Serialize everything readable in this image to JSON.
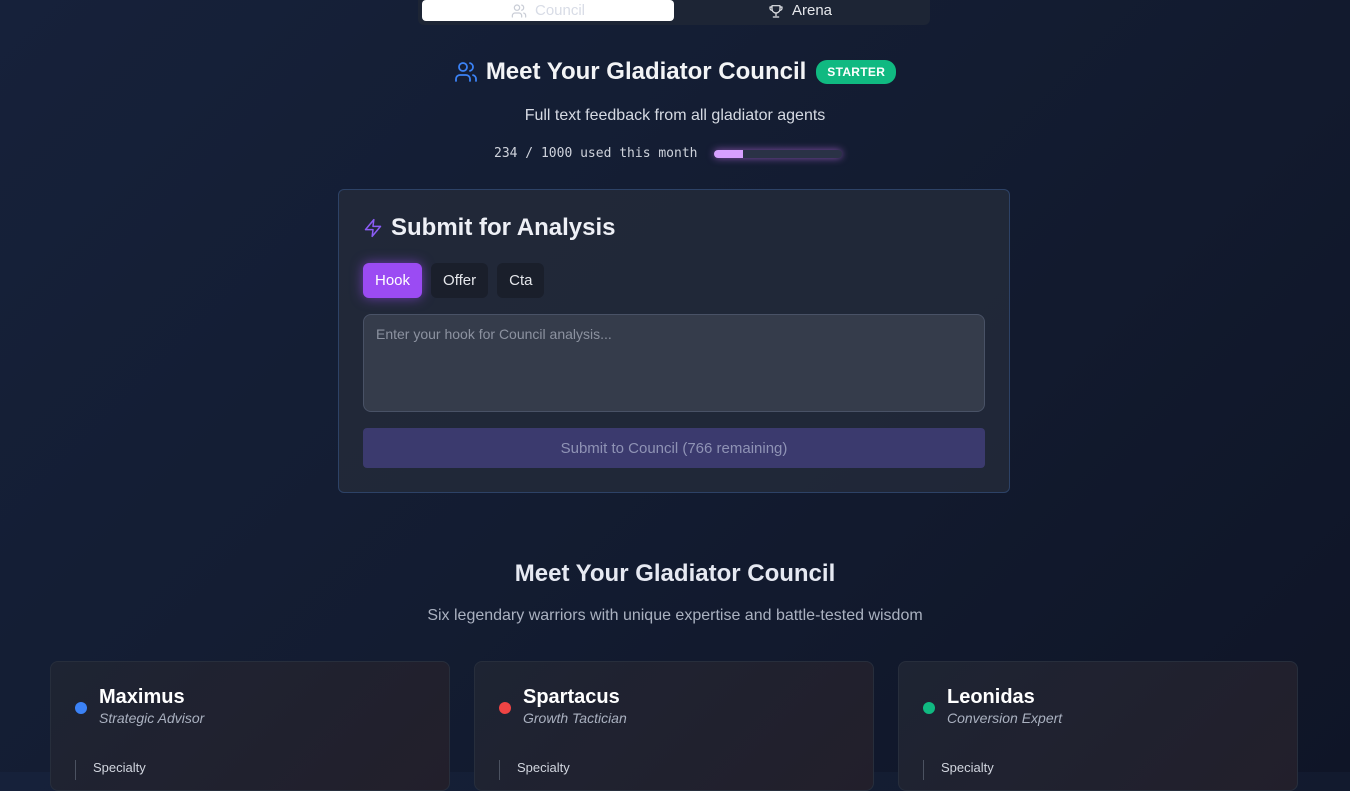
{
  "tabs": [
    {
      "label": "Council",
      "icon": "users-icon"
    },
    {
      "label": "Arena",
      "icon": "trophy-icon"
    }
  ],
  "header": {
    "title": "Meet Your Gladiator Council",
    "icon": "users-icon",
    "badge": "STARTER",
    "subtitle": "Full text feedback from all gladiator agents",
    "usage_text": "234 / 1000 used this month",
    "usage_fraction": 0.234
  },
  "submit_panel": {
    "title": "Submit for Analysis",
    "icon": "zap-icon",
    "modes": [
      "Hook",
      "Offer",
      "Cta"
    ],
    "active_mode": "Hook",
    "placeholder": "Enter your hook for Council analysis...",
    "value": "",
    "submit_label": "Submit to Council (766 remaining)"
  },
  "council_section": {
    "title": "Meet Your Gladiator Council",
    "subtitle": "Six legendary warriors with unique expertise and battle-tested wisdom",
    "members": [
      {
        "name": "Maximus",
        "role": "Strategic Advisor",
        "specialty_label": "Specialty",
        "color": "#3b82f6"
      },
      {
        "name": "Spartacus",
        "role": "Growth Tactician",
        "specialty_label": "Specialty",
        "color": "#ef4444"
      },
      {
        "name": "Leonidas",
        "role": "Conversion Expert",
        "specialty_label": "Specialty",
        "color": "#10b981"
      }
    ]
  },
  "colors": {
    "accent_purple": "#9b4bf3",
    "badge_green": "#10b981",
    "icon_blue": "#3b82f6"
  }
}
